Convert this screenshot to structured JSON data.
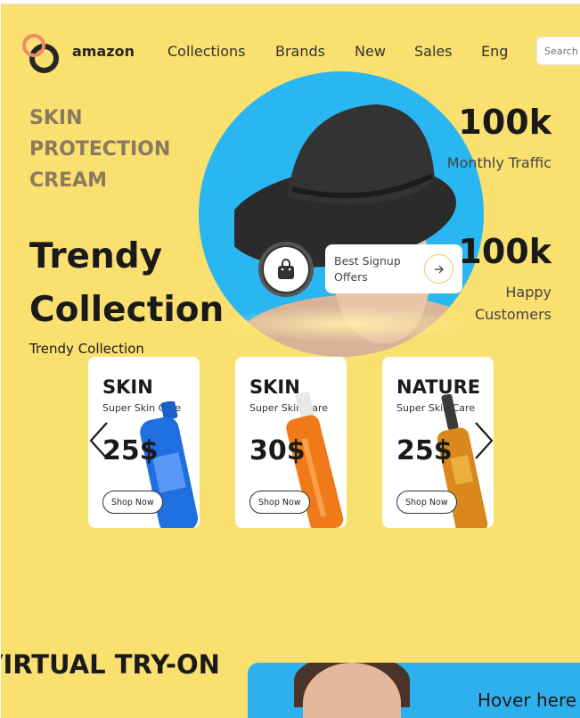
{
  "header": {
    "brand": "amazon",
    "nav": [
      "Collections",
      "Brands",
      "New",
      "Sales",
      "Eng"
    ],
    "search_placeholder": "Search"
  },
  "hero": {
    "tagline": "SKIN PROTECTION CREAM",
    "title": "Trendy Collection",
    "subtitle": "Trendy Collection",
    "offer_text": "Best Signup Offers",
    "stats": [
      {
        "value": "100k",
        "label": "Monthly Traffic"
      },
      {
        "value": "100k",
        "label": "Happy Customers"
      }
    ]
  },
  "products": [
    {
      "name": "SKIN",
      "desc": "Super Skin Care",
      "price": "25$",
      "button": "Shop Now"
    },
    {
      "name": "SKIN",
      "desc": "Super Skin Care",
      "price": "30$",
      "button": "Shop Now"
    },
    {
      "name": "NATURE",
      "desc": "Super Skin Care",
      "price": "25$",
      "button": "Shop Now"
    }
  ],
  "tryon": {
    "title": "VIRTUAL TRY-ON",
    "hover_text": "Hover here"
  },
  "icons": {
    "logo": "two-rings-logo",
    "bag": "shopping-bag-icon",
    "arrow": "arrow-right-icon",
    "prev": "chevron-left-icon",
    "next": "chevron-right-icon"
  },
  "colors": {
    "page_bg": "#fae06f",
    "hero_circle": "#2ab6f1",
    "accent": "#f0886c",
    "tagline": "#8a7a60"
  }
}
